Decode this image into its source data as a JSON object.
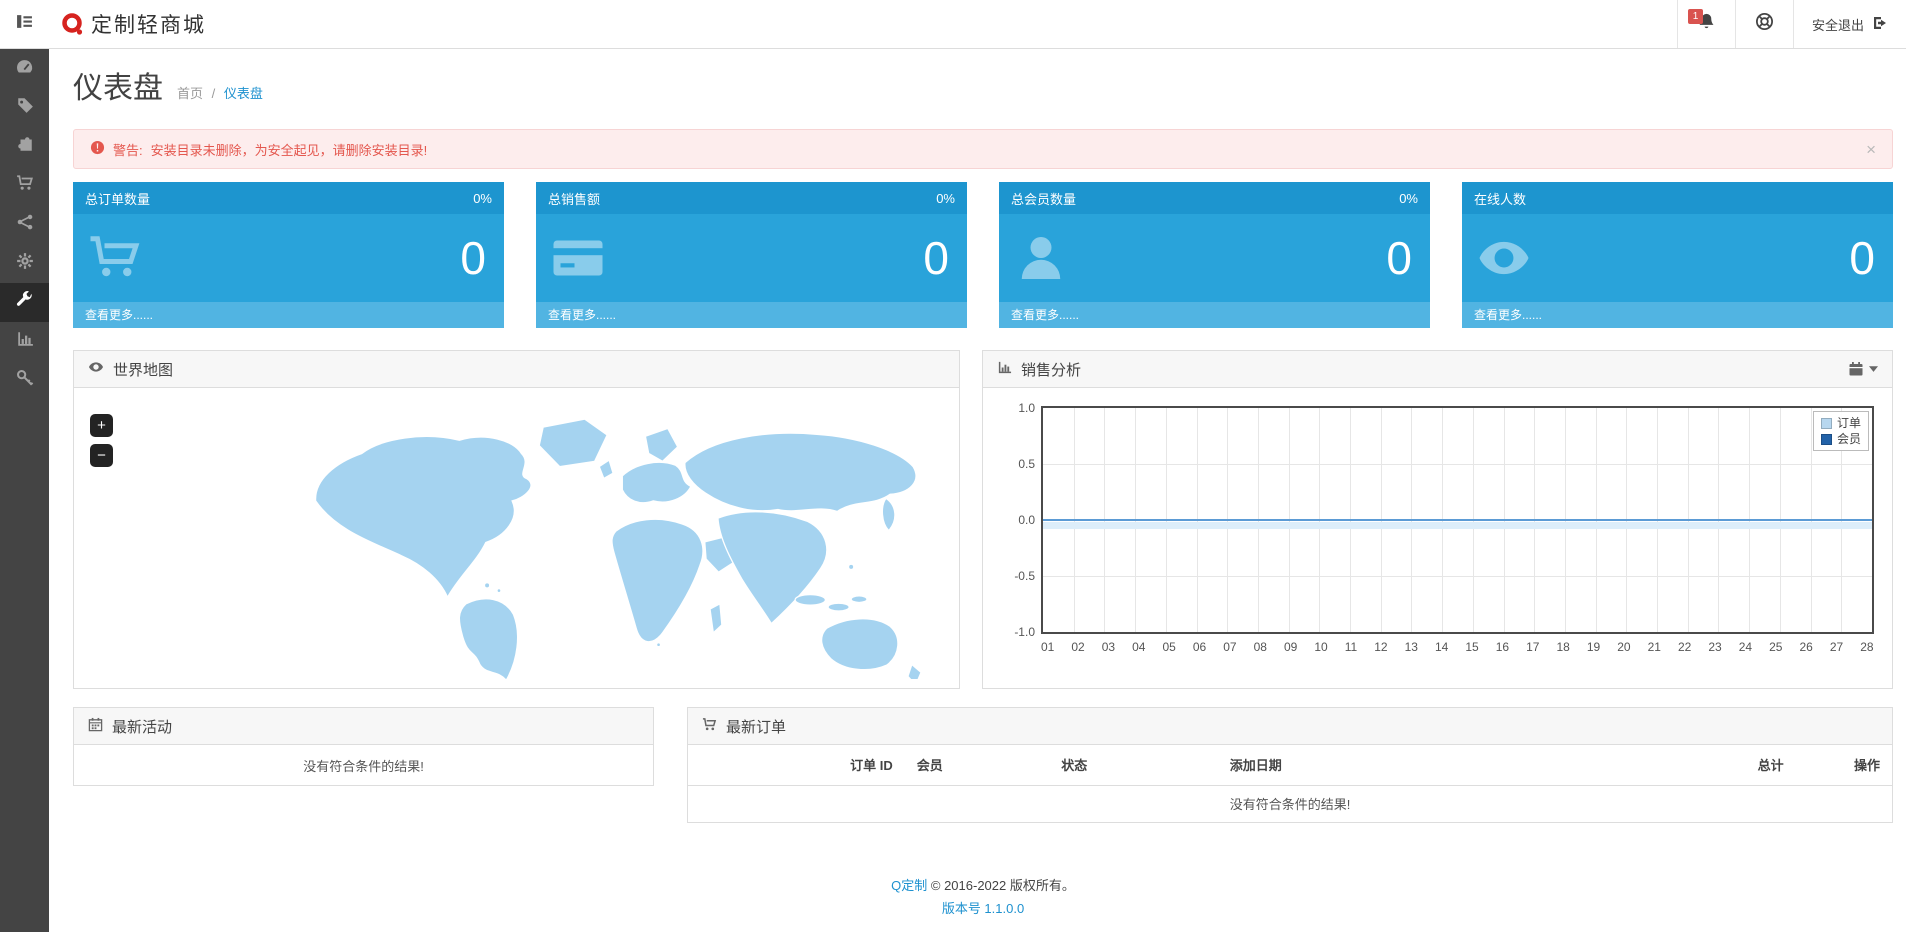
{
  "header": {
    "brand": "定制轻商城",
    "notification_badge": "1",
    "logout_label": "安全退出"
  },
  "sidebar": {
    "items": [
      {
        "id": "dashboard",
        "icon": "dashboard-icon"
      },
      {
        "id": "catalog",
        "icon": "tag-icon"
      },
      {
        "id": "extensions",
        "icon": "puzzle-icon"
      },
      {
        "id": "sales",
        "icon": "cart-icon"
      },
      {
        "id": "marketing",
        "icon": "share-icon"
      },
      {
        "id": "system",
        "icon": "gear-icon"
      },
      {
        "id": "tools",
        "icon": "wrench-icon",
        "active": true
      },
      {
        "id": "reports",
        "icon": "bar-chart-icon"
      },
      {
        "id": "api",
        "icon": "key-icon"
      }
    ]
  },
  "page": {
    "title": "仪表盘",
    "breadcrumb_home": "首页",
    "breadcrumb_sep": "/",
    "breadcrumb_current": "仪表盘"
  },
  "alert": {
    "label": "警告:",
    "text": "安装目录未删除，为安全起见，请删除安装目录!",
    "close": "×"
  },
  "stats": [
    {
      "title": "总订单数量",
      "percent": "0%",
      "value": "0",
      "more": "查看更多......"
    },
    {
      "title": "总销售额",
      "percent": "0%",
      "value": "0",
      "more": "查看更多......"
    },
    {
      "title": "总会员数量",
      "percent": "0%",
      "value": "0",
      "more": "查看更多......"
    },
    {
      "title": "在线人数",
      "percent": "",
      "value": "0",
      "more": "查看更多......"
    }
  ],
  "map_panel": {
    "title": "世界地图",
    "zoom_in": "+",
    "zoom_out": "−"
  },
  "sales_panel": {
    "title": "销售分析"
  },
  "chart_data": {
    "type": "line",
    "title": "销售分析",
    "x": [
      "01",
      "02",
      "03",
      "04",
      "05",
      "06",
      "07",
      "08",
      "09",
      "10",
      "11",
      "12",
      "13",
      "14",
      "15",
      "16",
      "17",
      "18",
      "19",
      "20",
      "21",
      "22",
      "23",
      "24",
      "25",
      "26",
      "27",
      "28"
    ],
    "y_ticks": [
      1.0,
      0.5,
      0.0,
      -0.5,
      -1.0
    ],
    "ylim": [
      -1.0,
      1.0
    ],
    "grid": true,
    "legend_position": "top-right",
    "line_color": "#5b9bd5",
    "series": [
      {
        "name": "订单",
        "color": "#b7d7ef",
        "values": [
          0,
          0,
          0,
          0,
          0,
          0,
          0,
          0,
          0,
          0,
          0,
          0,
          0,
          0,
          0,
          0,
          0,
          0,
          0,
          0,
          0,
          0,
          0,
          0,
          0,
          0,
          0,
          0
        ]
      },
      {
        "name": "会员",
        "color": "#2262a8",
        "values": [
          0,
          0,
          0,
          0,
          0,
          0,
          0,
          0,
          0,
          0,
          0,
          0,
          0,
          0,
          0,
          0,
          0,
          0,
          0,
          0,
          0,
          0,
          0,
          0,
          0,
          0,
          0,
          0
        ]
      }
    ]
  },
  "activity_panel": {
    "title": "最新活动",
    "empty": "没有符合条件的结果!"
  },
  "orders_panel": {
    "title": "最新订单",
    "columns": [
      "订单 ID",
      "会员",
      "状态",
      "添加日期",
      "总计",
      "操作"
    ],
    "empty": "没有符合条件的结果!"
  },
  "footer": {
    "copyright_link": "Q定制",
    "copyright_text": "© 2016-2022 版权所有。",
    "version": "版本号 1.1.0.0"
  },
  "colors": {
    "tile_header": "#1d95cf",
    "tile_body": "#29a3da",
    "tile_footer": "#51b4e2",
    "accent": "#1e91cf",
    "badge": "#d9534f",
    "alert_text": "#e4574e",
    "alert_bg": "#fdeded",
    "map_fill": "#a5d3f0",
    "chart_line": "#5b9bd5",
    "sidebar": "#444444",
    "sidebar_active": "#2a2a2a"
  }
}
